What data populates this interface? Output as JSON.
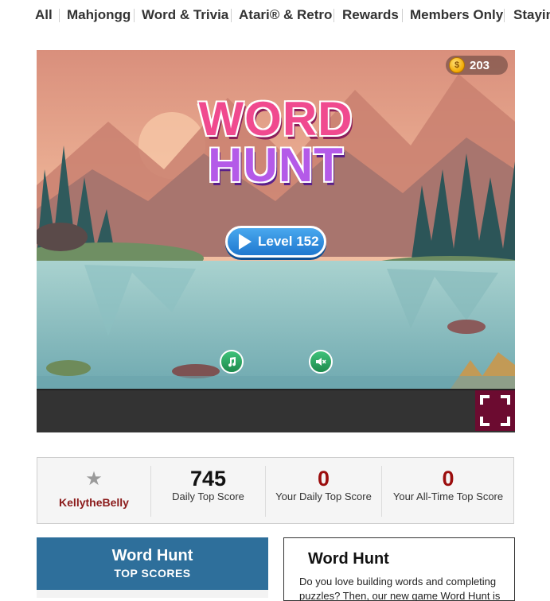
{
  "nav": {
    "items": [
      "All",
      "Mahjongg",
      "Word & Trivia",
      "Atari® & Retro",
      "Rewards",
      "Members Only",
      "Stayin"
    ]
  },
  "game": {
    "coin_symbol": "$",
    "coins": "203",
    "title_line1": "WORD",
    "title_line2": "HUNT",
    "level_label": "Level 152",
    "music_icon": "music-note-icon",
    "sound_icon": "speaker-mute-icon",
    "fullscreen_icon": "fullscreen-icon"
  },
  "scores": {
    "star": "★",
    "username": "KellytheBelly",
    "daily_top_value": "745",
    "daily_top_label": "Daily Top Score",
    "your_daily_value": "0",
    "your_daily_label": "Your Daily Top Score",
    "your_alltime_value": "0",
    "your_alltime_label": "Your All-Time Top Score"
  },
  "top_scores_card": {
    "title": "Word Hunt",
    "subtitle": "TOP SCORES"
  },
  "info_card": {
    "title": "Word Hunt",
    "text": "Do you love building words and completing puzzles? Then, our new game Word Hunt is"
  },
  "colors": {
    "accent_blue": "#2e6f9b",
    "score_red": "#9b0d0d",
    "fullscreen_bg": "#6c0b30"
  }
}
